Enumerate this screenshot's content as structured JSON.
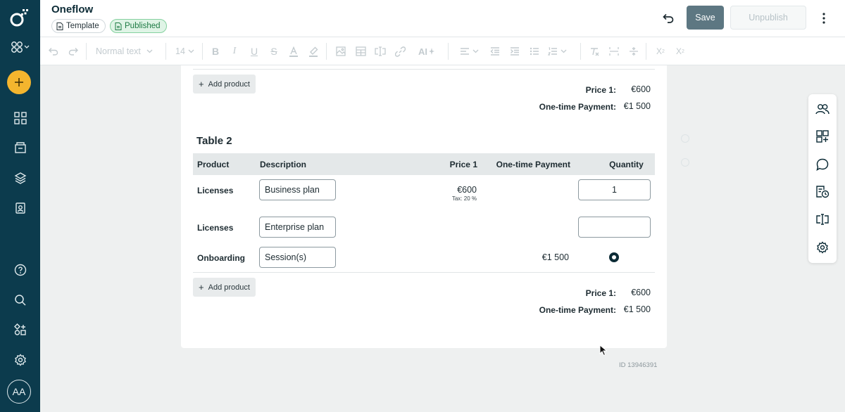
{
  "header": {
    "title": "Oneflow",
    "chip_template": "Template",
    "chip_published": "Published",
    "save_label": "Save",
    "unpublish_label": "Unpublish"
  },
  "toolbar": {
    "style_select": "Normal text",
    "font_size": "14",
    "ai_label": "AI"
  },
  "sidebar": {
    "avatar_initials": "AA",
    "icons": [
      "oneflow-logo",
      "workspace-switcher",
      "add",
      "dashboard",
      "documents",
      "templates",
      "contacts",
      "help",
      "search",
      "marketplace",
      "settings"
    ]
  },
  "document": {
    "table1_summary": {
      "add_product_label": "Add product",
      "price_label": "Price 1:",
      "price_value": "€600",
      "payment_label": "One-time Payment:",
      "payment_value": "€1 500"
    },
    "table2": {
      "title": "Table 2",
      "headers": [
        "Product",
        "Description",
        "Price 1",
        "One-time Payment",
        "Quantity"
      ],
      "rows": [
        {
          "product": "Licenses",
          "description": "Business plan",
          "price": "€600",
          "tax": "Tax: 20 %",
          "payment": "",
          "quantity": "1"
        },
        {
          "product": "Licenses",
          "description": "Enterprise plan",
          "price": "",
          "tax": "",
          "payment": "",
          "quantity": ""
        },
        {
          "product": "Onboarding",
          "description": "Session(s)",
          "price": "",
          "tax": "",
          "payment": "€1 500",
          "quantity": "selected"
        }
      ],
      "add_product_label": "Add product",
      "price_label": "Price 1:",
      "price_value": "€600",
      "payment_label": "One-time Payment:",
      "payment_value": "€1 500"
    },
    "doc_id": "ID 13946391"
  },
  "colors": {
    "sidebar_bg": "#0c3b4d",
    "accent_yellow": "#f4b52e",
    "save_bg": "#5d7782",
    "published_green": "#1d7a44"
  }
}
